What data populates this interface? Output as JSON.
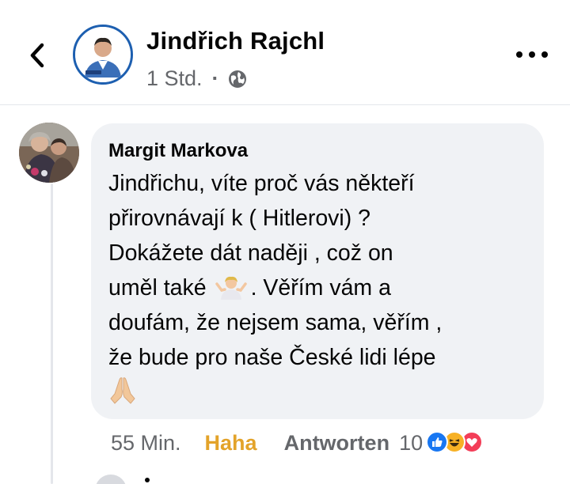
{
  "post_header": {
    "page_name": "Jindřich Rajchl",
    "time": "1 Std.",
    "separator": "·",
    "privacy_icon": "globe-icon",
    "back_icon": "chevron-left-icon",
    "more_icon": "more-dots-icon",
    "avatar_logo_text": "ROJCHL 2021"
  },
  "comment": {
    "author": "Margit Markova",
    "lines": [
      "Jindřichu, víte proč vás někteří",
      "přirovnávají k ( Hitlerovi)  ?",
      "Dokážete dát naději , což on",
      "uměl také",
      ". Věřím vám a",
      "doufám, že nejsem sama, věřím ,",
      "že bude pro naše České lidi lépe"
    ],
    "inline_emoji": "person-shrugging-emoji",
    "end_emoji": "folded-hands-emoji",
    "time": "55 Min.",
    "reaction_label": "Haha",
    "reply_label": "Antworten",
    "reaction_count": "10",
    "reaction_icons": [
      "like-icon",
      "haha-icon",
      "love-icon"
    ]
  },
  "colors": {
    "bubble_bg": "#f0f2f5",
    "secondary_text": "#65676b",
    "haha_active": "#e3a32a",
    "like_blue": "#1877f2",
    "love_red": "#f33e58"
  }
}
